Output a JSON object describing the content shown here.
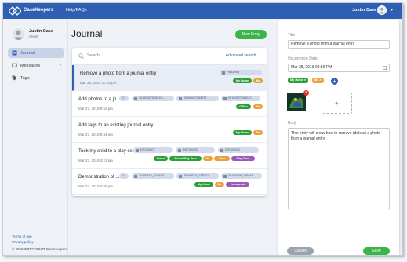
{
  "colors": {
    "primary": "#2f5fb3",
    "success": "#3bb54a",
    "my_home": "#2e9e3a",
    "me": "#e9a03c",
    "office": "#2e9e3a",
    "travel": "#2e9e3a",
    "school_day_care": "#2e9e3a",
    "kids": "#e9a03c",
    "play_time": "#9b59b6",
    "homework": "#9b59b6"
  },
  "topbar": {
    "brand": "CaseKeepers",
    "help_link": "Help/FAQs",
    "user_name": "Justin Case",
    "logo_icon": "diamond-logo-icon",
    "caret_icon": "chevron-down-icon"
  },
  "sidebar": {
    "user_name": "Justin Case",
    "user_role": "Client",
    "items": [
      {
        "label": "Journal",
        "icon": "book-icon",
        "active": true
      },
      {
        "label": "Messages",
        "icon": "chat-icon",
        "active": false,
        "arrow": "›"
      },
      {
        "label": "Tags",
        "icon": "tag-icon",
        "active": false
      }
    ],
    "terms_link": "Terms of use",
    "privacy_link": "Privacy policy",
    "copyright": "© 2019 COPYRIGHT CaseKeepers"
  },
  "main": {
    "title": "Journal",
    "new_entry_label": "New Entry",
    "search_placeholder": "Search",
    "advanced_search_label": "Advanced search ⌄",
    "entries": [
      {
        "title": "Remove a photo from a journal entry",
        "date": "Mar 28, 2019 10:00 pm",
        "chips": [
          "Pasuenia"
        ],
        "tags": [
          "My Home",
          "Me"
        ]
      },
      {
        "title": "Add photos to a jo...",
        "date": "Mar 27, 2019 9:52 pm",
        "chips": [
          "1+",
          "20190327093237...",
          "20190327093237...",
          "20190327093237..."
        ],
        "tags": [
          "Office",
          "Me"
        ]
      },
      {
        "title": "Add tags to an existing journal entry",
        "date": "Mar 27, 2019 9:44 pm",
        "chips": [],
        "tags": [
          "My Home",
          "Me"
        ]
      },
      {
        "title": "Took my child to a play ce...",
        "date": "Mar 27, 2019 3:21 pm",
        "chips": [
          "DSC00007",
          "DSC00005",
          "DSC00006"
        ],
        "tags": [
          "Travel",
          "School/Day Care",
          "Me",
          "Kids",
          "Play Time"
        ]
      },
      {
        "title": "Demonstration of ...",
        "date": "Mar 27, 2019 3:55 pm",
        "chips": [
          "1+",
          "20190310_125408",
          "20190310_135010",
          "20190308_165848"
        ],
        "tags": [
          "My Home",
          "Me",
          "Homework"
        ]
      }
    ]
  },
  "panel": {
    "title_label": "Title",
    "title_value": "Remove a photo from a journal entry",
    "date_label": "Occurrence Date",
    "date_value": "Mar 28, 2019 09:56 PM",
    "tags": [
      "My Home ×",
      "Me ×"
    ],
    "add_tag_label": "+",
    "add_photo_label": "+",
    "photo_remove_label": "×",
    "body_label": "Body",
    "body_value": "This entry will show how to remove (delete) a photo from a journal entry.",
    "cancel_label": "Cancel",
    "save_label": "Save"
  }
}
